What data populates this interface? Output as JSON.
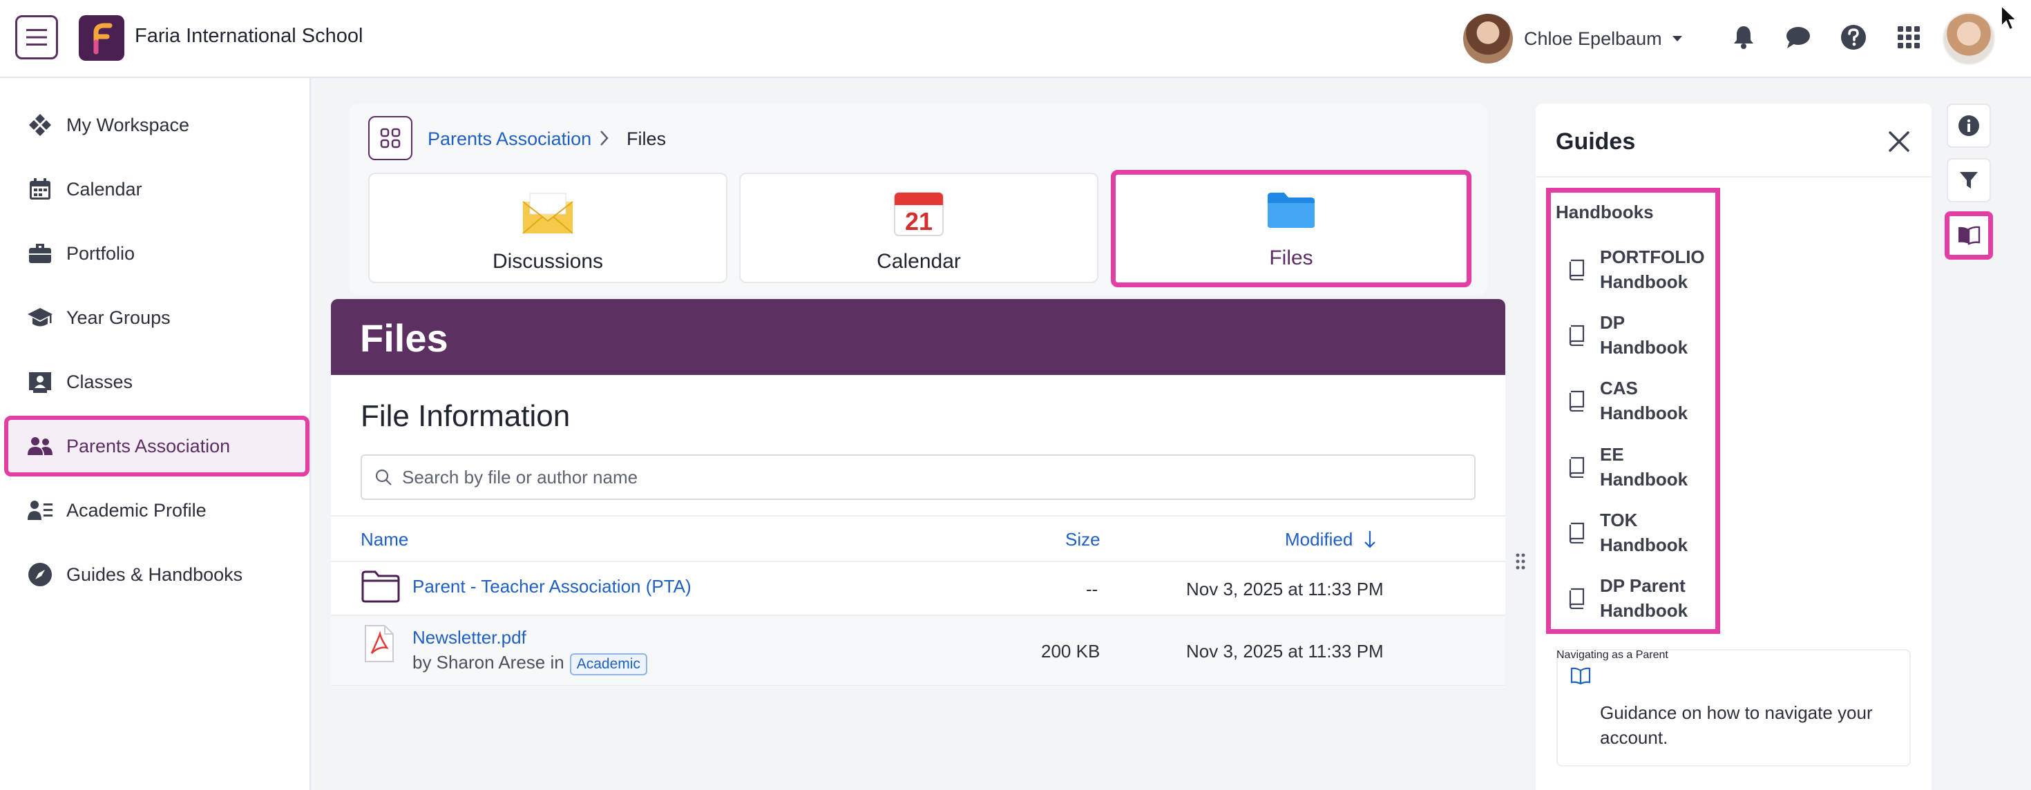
{
  "header": {
    "school_name": "Faria International School",
    "user_name": "Chloe Epelbaum"
  },
  "sidebar": {
    "items": [
      {
        "label": "My Workspace",
        "icon": "workspace-icon"
      },
      {
        "label": "Calendar",
        "icon": "calendar-icon"
      },
      {
        "label": "Portfolio",
        "icon": "briefcase-icon"
      },
      {
        "label": "Year Groups",
        "icon": "graduation-cap-icon"
      },
      {
        "label": "Classes",
        "icon": "classes-icon"
      },
      {
        "label": "Parents Association",
        "icon": "people-icon",
        "active": true
      },
      {
        "label": "Academic Profile",
        "icon": "profile-list-icon"
      },
      {
        "label": "Guides & Handbooks",
        "icon": "compass-icon"
      }
    ]
  },
  "breadcrumb": {
    "parent": "Parents Association",
    "current": "Files"
  },
  "apps": {
    "tiles": [
      {
        "label": "Discussions",
        "icon": "envelope-icon"
      },
      {
        "label": "Calendar",
        "icon": "calendar-icon"
      },
      {
        "label": "Files",
        "icon": "folder-icon",
        "active": true
      }
    ]
  },
  "files": {
    "banner_title": "Files",
    "section_title": "File Information",
    "search_placeholder": "Search by file or author name",
    "columns": {
      "name": "Name",
      "size": "Size",
      "modified": "Modified"
    },
    "rows": [
      {
        "name": "Parent - Teacher Association (PTA)",
        "size": "--",
        "modified": "Nov 3, 2025 at 11:33 PM",
        "type": "folder"
      },
      {
        "name": "Newsletter.pdf",
        "author_line": "by Sharon Arese in",
        "tag": "Academic",
        "size": "200 KB",
        "modified": "Nov 3, 2025 at 11:33 PM",
        "type": "pdf"
      }
    ]
  },
  "guides": {
    "title": "Guides",
    "section": "Handbooks",
    "handbooks": [
      {
        "line1": "PORTFOLIO",
        "line2": "Handbook"
      },
      {
        "line1": "DP",
        "line2": "Handbook"
      },
      {
        "line1": "CAS",
        "line2": "Handbook"
      },
      {
        "line1": "EE",
        "line2": "Handbook"
      },
      {
        "line1": "TOK",
        "line2": "Handbook"
      },
      {
        "line1": "DP Parent",
        "line2": "Handbook"
      }
    ],
    "nav_card": {
      "title": "Navigating as a Parent",
      "description": "Guidance on how to navigate your account."
    }
  },
  "colors": {
    "brand_purple": "#5c3060",
    "highlight_pink": "#e23ea3",
    "link_blue": "#1f5fc4"
  }
}
